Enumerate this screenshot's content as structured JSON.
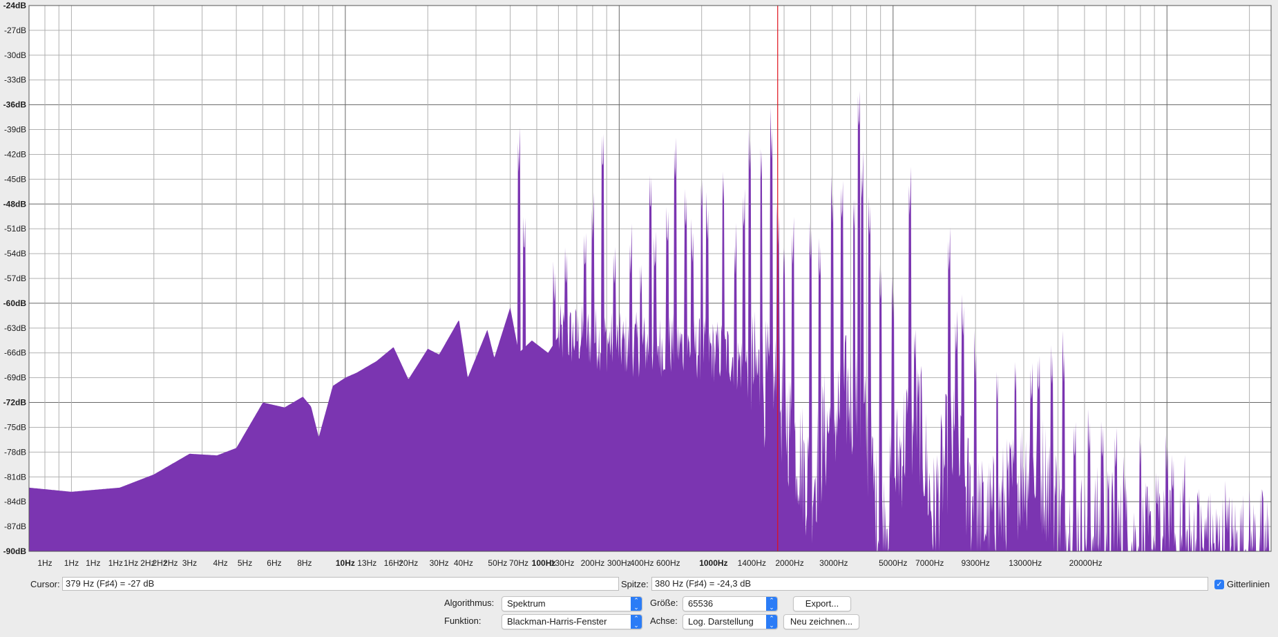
{
  "spectrum_view": {
    "db_axis_labels": [
      "-24dB",
      "-27dB",
      "-30dB",
      "-33dB",
      "-36dB",
      "-39dB",
      "-42dB",
      "-45dB",
      "-48dB",
      "-51dB",
      "-54dB",
      "-57dB",
      "-60dB",
      "-63dB",
      "-66dB",
      "-69dB",
      "-72dB",
      "-75dB",
      "-78dB",
      "-81dB",
      "-84dB",
      "-87dB",
      "-90dB"
    ],
    "bold_db_labels": [
      "-24dB",
      "-36dB",
      "-48dB",
      "-60dB",
      "-72dB",
      "-90dB"
    ],
    "freq_axis_labels": [
      "1Hz",
      "1Hz",
      "1Hz",
      "1Hz",
      "1Hz",
      "2Hz",
      "2Hz",
      "2Hz",
      "3Hz",
      "4Hz",
      "5Hz",
      "6Hz",
      "8Hz",
      "10Hz",
      "13Hz",
      "16Hz",
      "20Hz",
      "30Hz",
      "40Hz",
      "50Hz",
      "70Hz",
      "100Hz",
      "130Hz",
      "200Hz",
      "300Hz",
      "400Hz",
      "600Hz",
      "1000Hz",
      "1400Hz",
      "2000Hz",
      "3000Hz",
      "5000Hz",
      "7000Hz",
      "9300Hz",
      "13000Hz",
      "20000Hz"
    ],
    "bold_freq_labels": [
      "10Hz",
      "100Hz",
      "1000Hz"
    ],
    "fill_color": "#7b35b1",
    "cursor_line_color": "#e0101a",
    "cursor_frequency_hz": 379
  },
  "cursor": {
    "label": "Cursor:",
    "value": "379 Hz (F♯4) = -27 dB"
  },
  "peak": {
    "label": "Spitze:",
    "value": "380 Hz (F♯4) = -24,3 dB"
  },
  "gridlines": {
    "label": "Gitterlinien",
    "checked": true
  },
  "algorithm": {
    "label": "Algorithmus:",
    "value": "Spektrum"
  },
  "size": {
    "label": "Größe:",
    "value": "65536"
  },
  "function": {
    "label": "Funktion:",
    "value": "Blackman-Harris-Fenster"
  },
  "axis": {
    "label": "Achse:",
    "value": "Log. Darstellung"
  },
  "buttons": {
    "export": "Export...",
    "redraw": "Neu zeichnen..."
  },
  "icons": {
    "stepper": "up-down-chevron-icon",
    "checkmark": "checkmark-icon"
  }
}
